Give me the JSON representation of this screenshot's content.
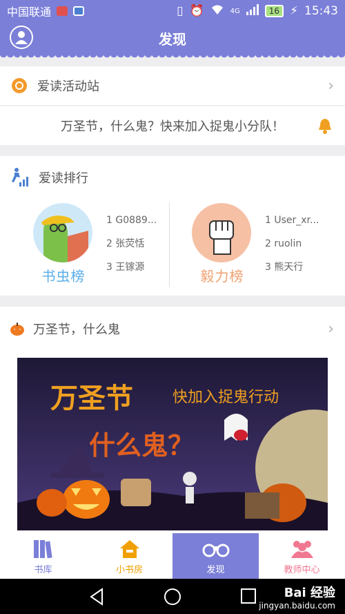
{
  "status_bar": {
    "carrier": "中国联通",
    "network": "4G",
    "battery": "16",
    "time": "15:43"
  },
  "header": {
    "title": "发现"
  },
  "activity": {
    "label": "爱读活动站",
    "notice": "万圣节，什么鬼？快来加入捉鬼小分队！"
  },
  "ranking": {
    "label": "爱读排行",
    "boards": [
      {
        "title": "书虫榜",
        "color": "#5aaee8",
        "entries": [
          "1 G0889...",
          "2 张荧恬",
          "3 王镓源"
        ]
      },
      {
        "title": "毅力榜",
        "color": "#f0a070",
        "entries": [
          "1 User_xr...",
          "2 ruolin",
          "3 熊天行"
        ]
      }
    ]
  },
  "topic": {
    "label": "万圣节，什么鬼",
    "banner_title": "万圣节",
    "banner_subtitle": "快加入捉鬼行动",
    "banner_question": "什么鬼？"
  },
  "bottom_nav": [
    {
      "label": "书库",
      "color": "#7b7fd8"
    },
    {
      "label": "小书房",
      "color": "#f0a000"
    },
    {
      "label": "发现",
      "color": "#ffffff",
      "active": true
    },
    {
      "label": "教师中心",
      "color": "#f07890"
    }
  ],
  "watermark": {
    "brand": "Bai 经验",
    "site": "jingyan.baidu.com"
  }
}
